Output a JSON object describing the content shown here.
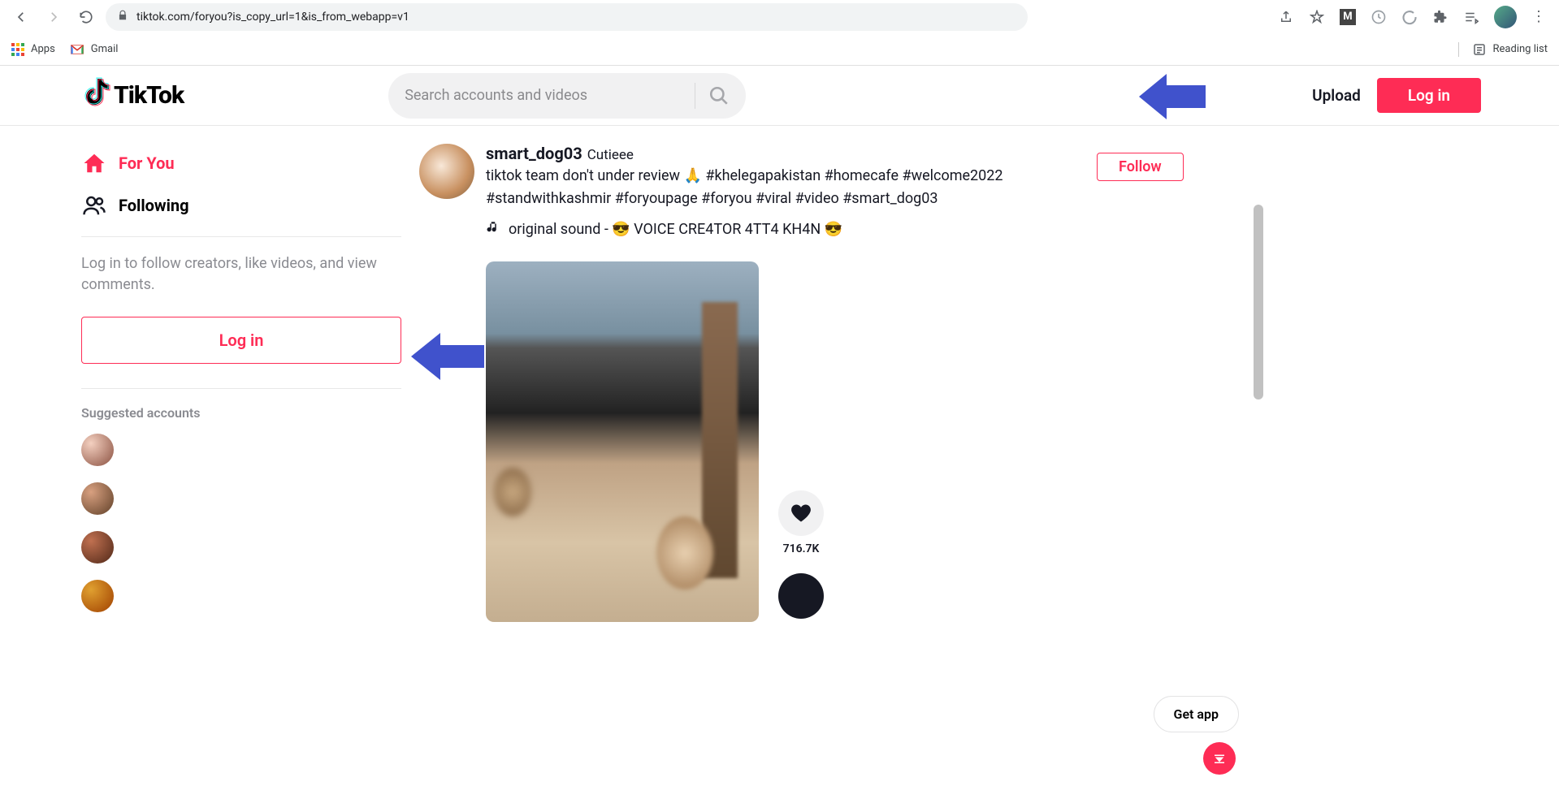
{
  "browser": {
    "url": "tiktok.com/foryou?is_copy_url=1&is_from_webapp=v1",
    "bookmarks": {
      "apps": "Apps",
      "gmail": "Gmail"
    },
    "reading_list": "Reading list"
  },
  "header": {
    "logo_text": "TikTok",
    "search_placeholder": "Search accounts and videos",
    "upload": "Upload",
    "login": "Log in"
  },
  "sidebar": {
    "for_you": "For You",
    "following": "Following",
    "login_prompt": "Log in to follow creators, like videos, and view comments.",
    "login_button": "Log in",
    "suggested_title": "Suggested accounts"
  },
  "post": {
    "username": "smart_dog03",
    "nickname": "Cutieee",
    "caption": "tiktok team don't under review 🙏 #khelegapakistan #homecafe #welcome2022 #standwithkashmir #foryoupage #foryou #viral #video #smart_dog03",
    "sound": "original sound - 😎 VOICE CRE4TOR 4TT4 KH4N 😎",
    "follow": "Follow",
    "like_count": "716.7K"
  },
  "footer": {
    "get_app": "Get app"
  }
}
